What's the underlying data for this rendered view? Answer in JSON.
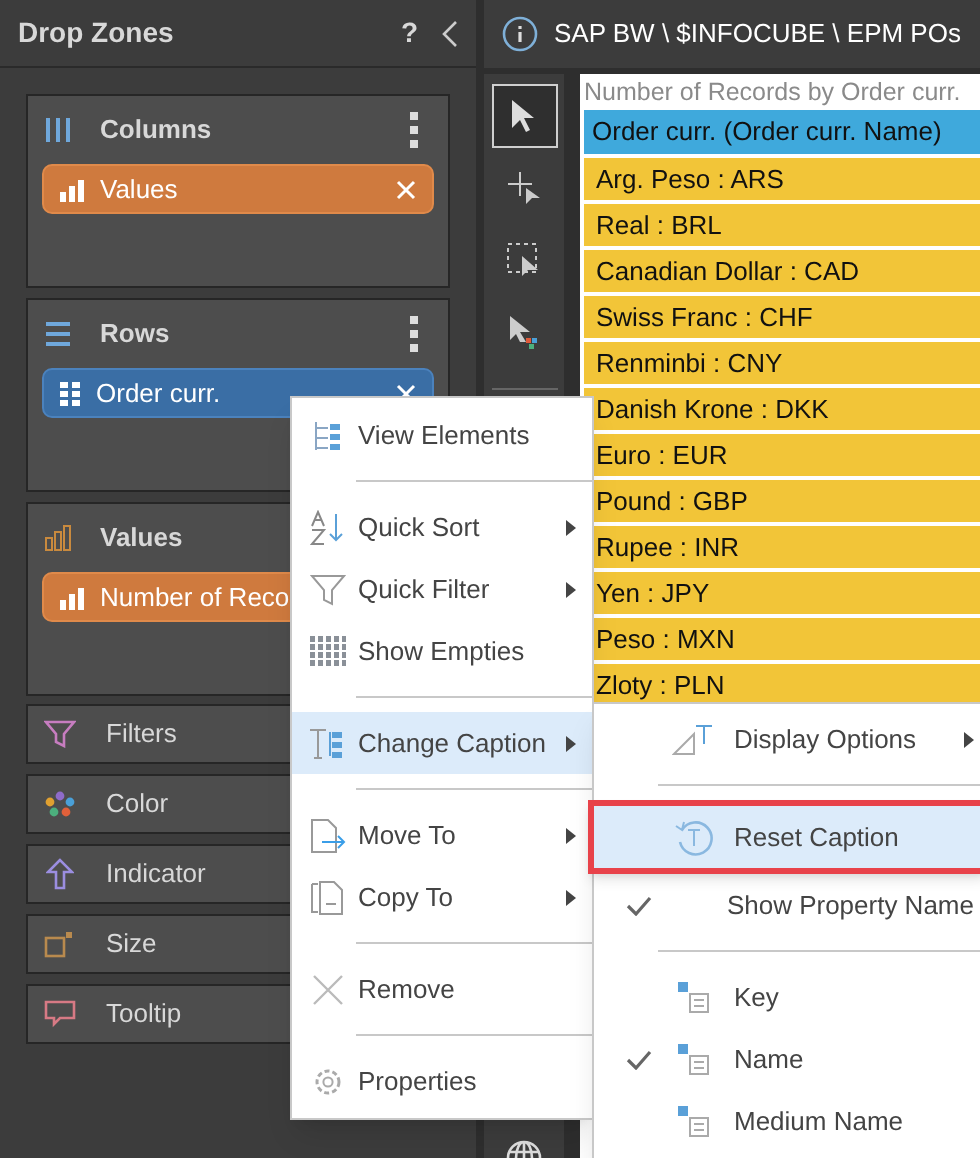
{
  "panel": {
    "title": "Drop Zones",
    "help": "?"
  },
  "zones": [
    {
      "kind": "columns",
      "title": "Columns",
      "chips": [
        {
          "label": "Values",
          "kind": "measure",
          "removable": true
        }
      ]
    },
    {
      "kind": "rows",
      "title": "Rows",
      "chips": [
        {
          "label": "Order curr.",
          "kind": "dimension",
          "removable": true
        }
      ]
    },
    {
      "kind": "values",
      "title": "Values",
      "chips": [
        {
          "label": "Number of Reco",
          "kind": "measure"
        }
      ]
    }
  ],
  "slots": [
    {
      "kind": "filters",
      "title": "Filters"
    },
    {
      "kind": "color",
      "title": "Color"
    },
    {
      "kind": "indicator",
      "title": "Indicator"
    },
    {
      "kind": "size",
      "title": "Size"
    },
    {
      "kind": "tooltip",
      "title": "Tooltip"
    }
  ],
  "breadcrumb": "SAP BW \\ $INFOCUBE \\ EPM POs",
  "tools": [
    {
      "selected": true
    },
    {
      "selected": false
    },
    {
      "selected": false
    },
    {
      "selected": false
    }
  ],
  "grid": {
    "caption": "Number of Records by Order curr.",
    "header": "Order curr. (Order curr. Name)",
    "rows": [
      "Arg. Peso : ARS",
      "Real : BRL",
      "Canadian Dollar : CAD",
      "Swiss Franc : CHF",
      "Renminbi : CNY",
      "Danish Krone : DKK",
      "Euro : EUR",
      "Pound : GBP",
      "Rupee : INR",
      "Yen : JPY",
      "Peso : MXN",
      "Zloty : PLN"
    ]
  },
  "menu": [
    {
      "kind": "item",
      "label": "View Elements",
      "submenu": false,
      "highlighted": false
    },
    {
      "kind": "divider"
    },
    {
      "kind": "item",
      "label": "Quick Sort",
      "submenu": true,
      "highlighted": false
    },
    {
      "kind": "item",
      "label": "Quick Filter",
      "submenu": true,
      "highlighted": false
    },
    {
      "kind": "item",
      "label": "Show Empties",
      "submenu": false,
      "highlighted": false
    },
    {
      "kind": "divider"
    },
    {
      "kind": "item",
      "label": "Change Caption",
      "submenu": true,
      "highlighted": true
    },
    {
      "kind": "divider"
    },
    {
      "kind": "item",
      "label": "Move To",
      "submenu": true,
      "highlighted": false
    },
    {
      "kind": "item",
      "label": "Copy To",
      "submenu": true,
      "highlighted": false
    },
    {
      "kind": "divider"
    },
    {
      "kind": "item",
      "label": "Remove",
      "submenu": false,
      "highlighted": false
    },
    {
      "kind": "divider"
    },
    {
      "kind": "item",
      "label": "Properties",
      "submenu": false,
      "highlighted": false
    }
  ],
  "submenu": [
    {
      "kind": "item",
      "label": "Display Options",
      "submenu": true,
      "highlighted": false,
      "checked": false,
      "outlined": false
    },
    {
      "kind": "divider"
    },
    {
      "kind": "item",
      "label": "Reset Caption",
      "submenu": false,
      "highlighted": true,
      "checked": false,
      "outlined": true
    },
    {
      "kind": "item",
      "label": "Show Property Name",
      "submenu": false,
      "highlighted": false,
      "checked": true,
      "outlined": false
    },
    {
      "kind": "divider"
    },
    {
      "kind": "item",
      "label": "Key",
      "submenu": false,
      "highlighted": false,
      "checked": false,
      "outlined": false
    },
    {
      "kind": "item",
      "label": "Name",
      "submenu": false,
      "highlighted": false,
      "checked": true,
      "outlined": false
    },
    {
      "kind": "item",
      "label": "Medium Name",
      "submenu": false,
      "highlighted": false,
      "checked": false,
      "outlined": false
    }
  ]
}
